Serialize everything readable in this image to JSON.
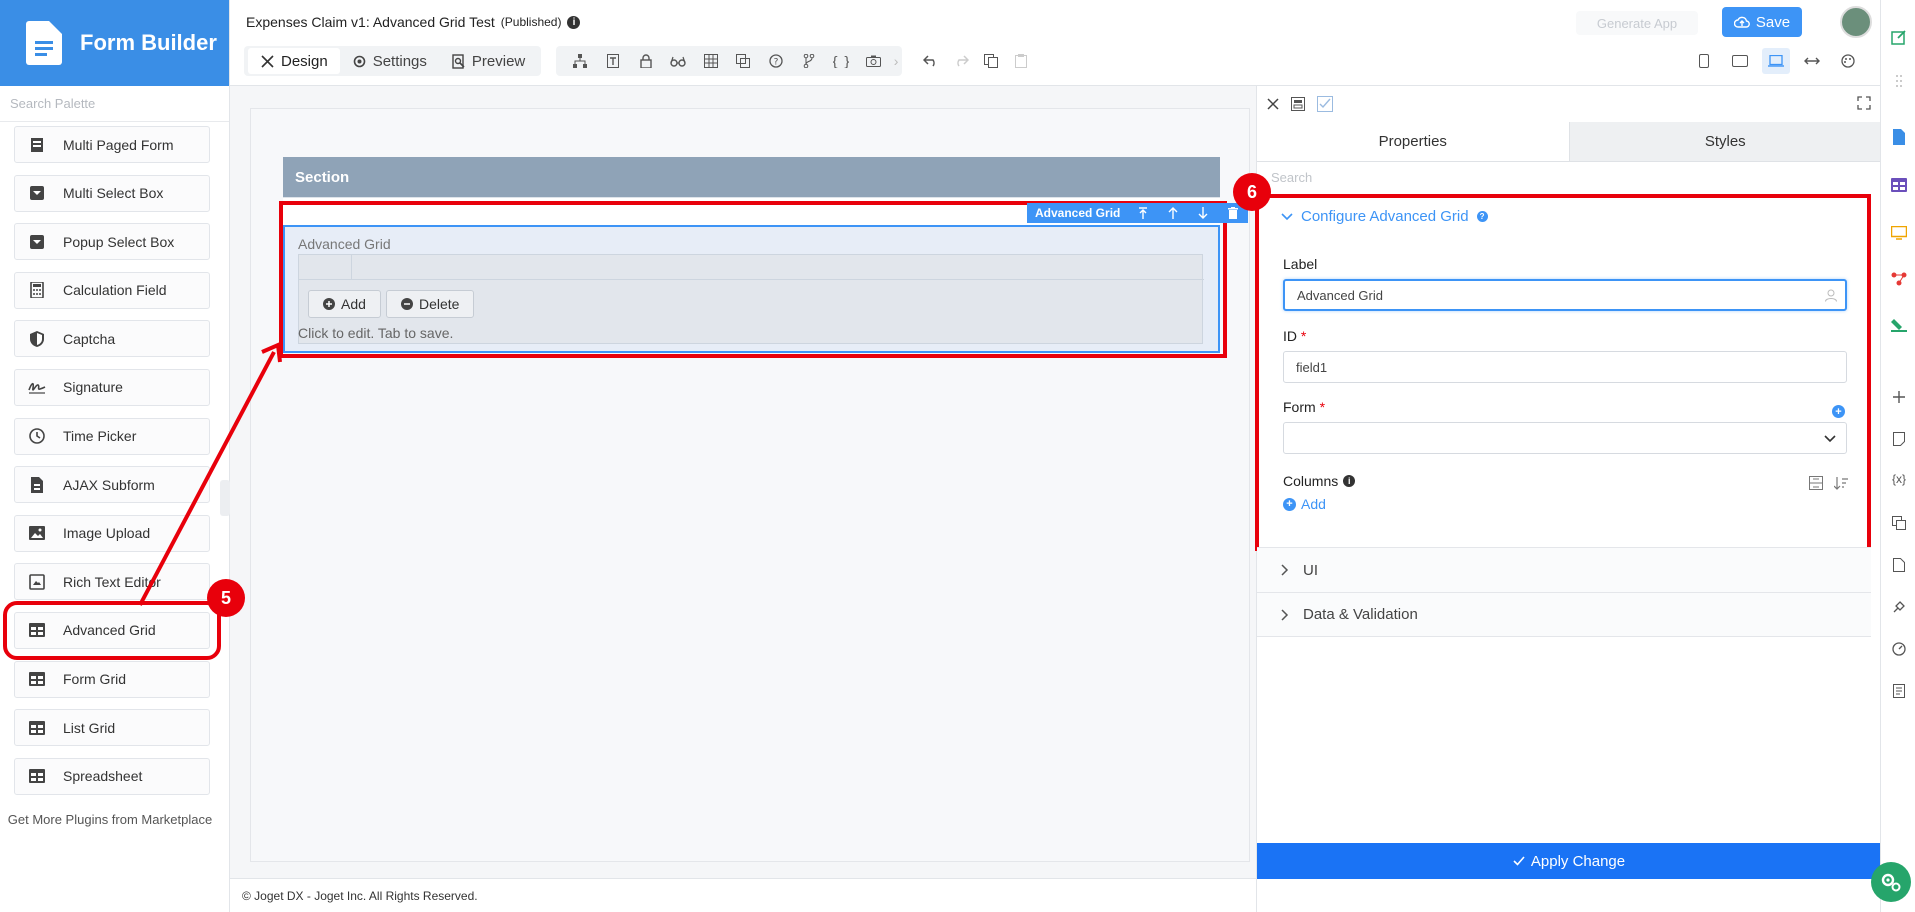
{
  "brand": {
    "title": "Form Builder"
  },
  "palette": {
    "search_placeholder": "Search Palette",
    "items": [
      {
        "label": "Multi Paged Form",
        "icon": "multi-page-icon"
      },
      {
        "label": "Multi Select Box",
        "icon": "select-box-icon"
      },
      {
        "label": "Popup Select Box",
        "icon": "popup-select-icon"
      },
      {
        "label": "Calculation Field",
        "icon": "calculator-icon"
      },
      {
        "label": "Captcha",
        "icon": "shield-icon"
      },
      {
        "label": "Signature",
        "icon": "signature-icon"
      },
      {
        "label": "Time Picker",
        "icon": "clock-icon"
      },
      {
        "label": "AJAX Subform",
        "icon": "subform-icon"
      },
      {
        "label": "Image Upload",
        "icon": "image-icon"
      },
      {
        "label": "Rich Text Editor",
        "icon": "rich-text-icon"
      },
      {
        "label": "Advanced Grid",
        "icon": "grid-icon"
      },
      {
        "label": "Form Grid",
        "icon": "grid-icon"
      },
      {
        "label": "List Grid",
        "icon": "grid-icon"
      },
      {
        "label": "Spreadsheet",
        "icon": "grid-icon"
      }
    ],
    "footer": "Get More Plugins from Marketplace"
  },
  "topbar": {
    "app_title": "Expenses Claim v1: Advanced Grid Test",
    "status": "(Published)",
    "modes": [
      "Design",
      "Settings",
      "Preview"
    ],
    "generate_label": "Generate App",
    "save_label": "Save"
  },
  "canvas": {
    "section_title": "Section",
    "grid_toolbar_label": "Advanced Grid",
    "grid_label": "Advanced Grid",
    "add_label": "Add",
    "delete_label": "Delete",
    "hint": "Click to edit. Tab to save."
  },
  "properties": {
    "tabs": [
      "Properties",
      "Styles"
    ],
    "search_placeholder": "Search",
    "config_title": "Configure Advanced Grid",
    "label_label": "Label",
    "label_value": "Advanced Grid",
    "id_label": "ID",
    "id_value": "field1",
    "form_label": "Form",
    "form_value": "",
    "columns_label": "Columns",
    "columns_add": "Add",
    "sections": [
      "UI",
      "Data & Validation"
    ],
    "apply_label": "Apply Change"
  },
  "annotations": {
    "badge_5": "5",
    "badge_6": "6"
  },
  "footer": {
    "copyright": "© Joget DX - Joget Inc. All Rights Reserved."
  },
  "colors": {
    "accent": "#3d94f6",
    "highlight": "#e8000b",
    "brand": "#3a8ee6",
    "apply": "#1a73f5"
  }
}
